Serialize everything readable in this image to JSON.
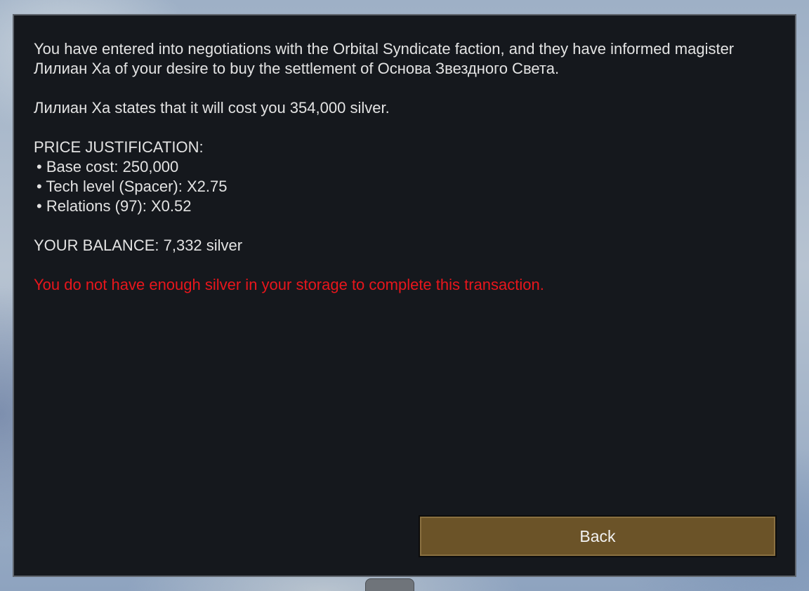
{
  "dialog": {
    "paragraph1": "You have entered into negotiations with the Orbital Syndicate faction, and they have informed magister Лилиан Ха of your desire to buy the settlement of Основа Звездного Света.",
    "paragraph2": "Лилиан Ха states that it will cost you 354,000 silver.",
    "justification_heading": "PRICE JUSTIFICATION:",
    "justification_items": [
      "Base cost: 250,000",
      "Tech level (Spacer): X2.75",
      "Relations (97): X0.52"
    ],
    "balance": "YOUR BALANCE: 7,332 silver",
    "warning": "You do not have enough silver in your storage to complete this transaction.",
    "back_label": "Back"
  },
  "colors": {
    "dialog_background": "#15181d",
    "text": "#e3e3e3",
    "warning": "#e8161c",
    "button_background": "#6b5328"
  }
}
